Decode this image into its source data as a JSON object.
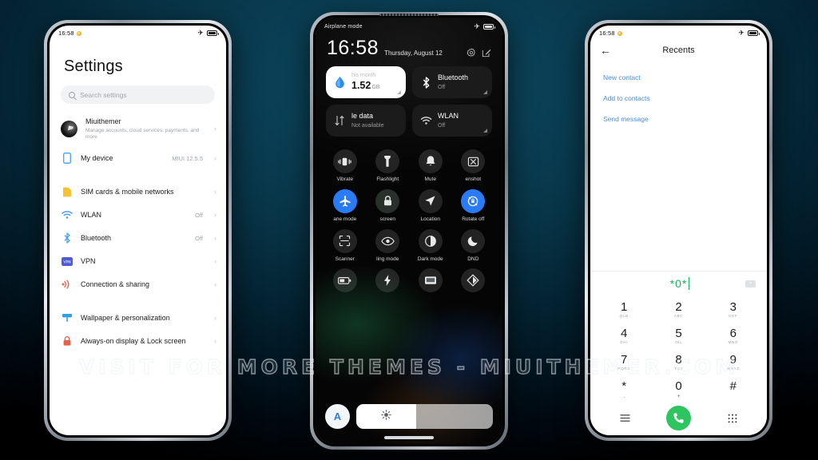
{
  "watermark": "VISIT FOR MORE THEMES - MIUITHEMER.COM",
  "phone_left": {
    "statusbar": {
      "time": "16:58",
      "battery_icon": "battery-icon",
      "airplane_icon": "airplane-mode-icon"
    },
    "title": "Settings",
    "search": {
      "placeholder": "Search settings",
      "icon": "search-icon"
    },
    "items": [
      {
        "label": "Miuithemer",
        "sub": "Manage accounts, cloud services, payments, and more",
        "value": "",
        "icon": "account-avatar"
      },
      {
        "label": "My device",
        "sub": "",
        "value": "MIUI 12.5.5",
        "icon": "device-icon"
      },
      {
        "label": "SIM cards & mobile networks",
        "sub": "",
        "value": "",
        "icon": "sim-card-icon"
      },
      {
        "label": "WLAN",
        "sub": "",
        "value": "Off",
        "icon": "wifi-icon"
      },
      {
        "label": "Bluetooth",
        "sub": "",
        "value": "Off",
        "icon": "bluetooth-icon"
      },
      {
        "label": "VPN",
        "sub": "",
        "value": "",
        "icon": "vpn-icon"
      },
      {
        "label": "Connection & sharing",
        "sub": "",
        "value": "",
        "icon": "connection-sharing-icon"
      },
      {
        "label": "Wallpaper & personalization",
        "sub": "",
        "value": "",
        "icon": "wallpaper-icon"
      },
      {
        "label": "Always-on display & Lock screen",
        "sub": "",
        "value": "",
        "icon": "lock-icon"
      }
    ]
  },
  "phone_center": {
    "statusbar": {
      "label": "Airplane mode",
      "airplane_icon": "airplane-mode-icon",
      "battery_icon": "battery-icon"
    },
    "clock": {
      "time": "16:58",
      "date": "Thursday, August 12"
    },
    "header_icons": {
      "settings": "gear-icon",
      "edit": "edit-icon"
    },
    "tiles": [
      {
        "kind": "data-usage",
        "top": "his month",
        "value": "1.52",
        "unit": "GB",
        "icon": "data-usage-icon",
        "active": true
      },
      {
        "kind": "bluetooth",
        "name": "Bluetooth",
        "state": "Off",
        "icon": "bluetooth-icon",
        "active": false
      },
      {
        "kind": "mobile-data",
        "name": "le data",
        "state": "Not available",
        "icon": "mobile-data-icon",
        "active": false
      },
      {
        "kind": "wlan",
        "name": "WLAN",
        "state": "Off",
        "icon": "wifi-icon",
        "active": false
      }
    ],
    "toggles": [
      {
        "label": "Vibrate",
        "icon": "vibrate-icon",
        "on": false
      },
      {
        "label": "Flashlight",
        "icon": "flashlight-icon",
        "on": false
      },
      {
        "label": "Mute",
        "icon": "bell-mute-icon",
        "on": false
      },
      {
        "label": "enshot",
        "icon": "screenshot-icon",
        "on": false
      },
      {
        "label": "ane mode",
        "icon": "airplane-mode-icon",
        "on": true
      },
      {
        "label": "screen",
        "icon": "lock-screen-icon",
        "on": false
      },
      {
        "label": "Location",
        "icon": "location-icon",
        "on": false
      },
      {
        "label": "Rotate off",
        "icon": "rotate-lock-icon",
        "on": true
      },
      {
        "label": "Scanner",
        "icon": "scanner-icon",
        "on": false
      },
      {
        "label": "ling mode",
        "icon": "reading-mode-icon",
        "on": false
      },
      {
        "label": "Dark mode",
        "icon": "dark-mode-icon",
        "on": false
      },
      {
        "label": "DND",
        "icon": "moon-icon",
        "on": false
      },
      {
        "label": "",
        "icon": "battery-saver-icon",
        "on": false
      },
      {
        "label": "",
        "icon": "power-icon",
        "on": false
      },
      {
        "label": "",
        "icon": "cast-icon",
        "on": false
      },
      {
        "label": "",
        "icon": "theme-icon",
        "on": false
      }
    ],
    "brightness": {
      "auto_label": "A",
      "icon": "brightness-icon",
      "level": 44
    }
  },
  "phone_right": {
    "statusbar": {
      "time": "16:58",
      "battery_icon": "battery-icon",
      "airplane_icon": "airplane-mode-icon"
    },
    "back_icon": "back-arrow-icon",
    "title": "Recents",
    "actions": [
      {
        "label": "New contact"
      },
      {
        "label": "Add to contacts"
      },
      {
        "label": "Send message"
      }
    ],
    "input": {
      "value": "*0*",
      "backspace_icon": "backspace-icon"
    },
    "keys": [
      {
        "num": "1",
        "sub": "QLD"
      },
      {
        "num": "2",
        "sub": "ABC"
      },
      {
        "num": "3",
        "sub": "DEF"
      },
      {
        "num": "4",
        "sub": "GHI"
      },
      {
        "num": "5",
        "sub": "JKL"
      },
      {
        "num": "6",
        "sub": "MNO"
      },
      {
        "num": "7",
        "sub": "PQRS"
      },
      {
        "num": "8",
        "sub": "TUV"
      },
      {
        "num": "9",
        "sub": "WXYZ"
      },
      {
        "num": "*",
        "sub": "."
      },
      {
        "num": "0",
        "sub": "+"
      },
      {
        "num": "#",
        "sub": ""
      }
    ],
    "bottom": {
      "menu_icon": "menu-icon",
      "call_icon": "call-icon",
      "keypad_icon": "keypad-icon"
    }
  }
}
